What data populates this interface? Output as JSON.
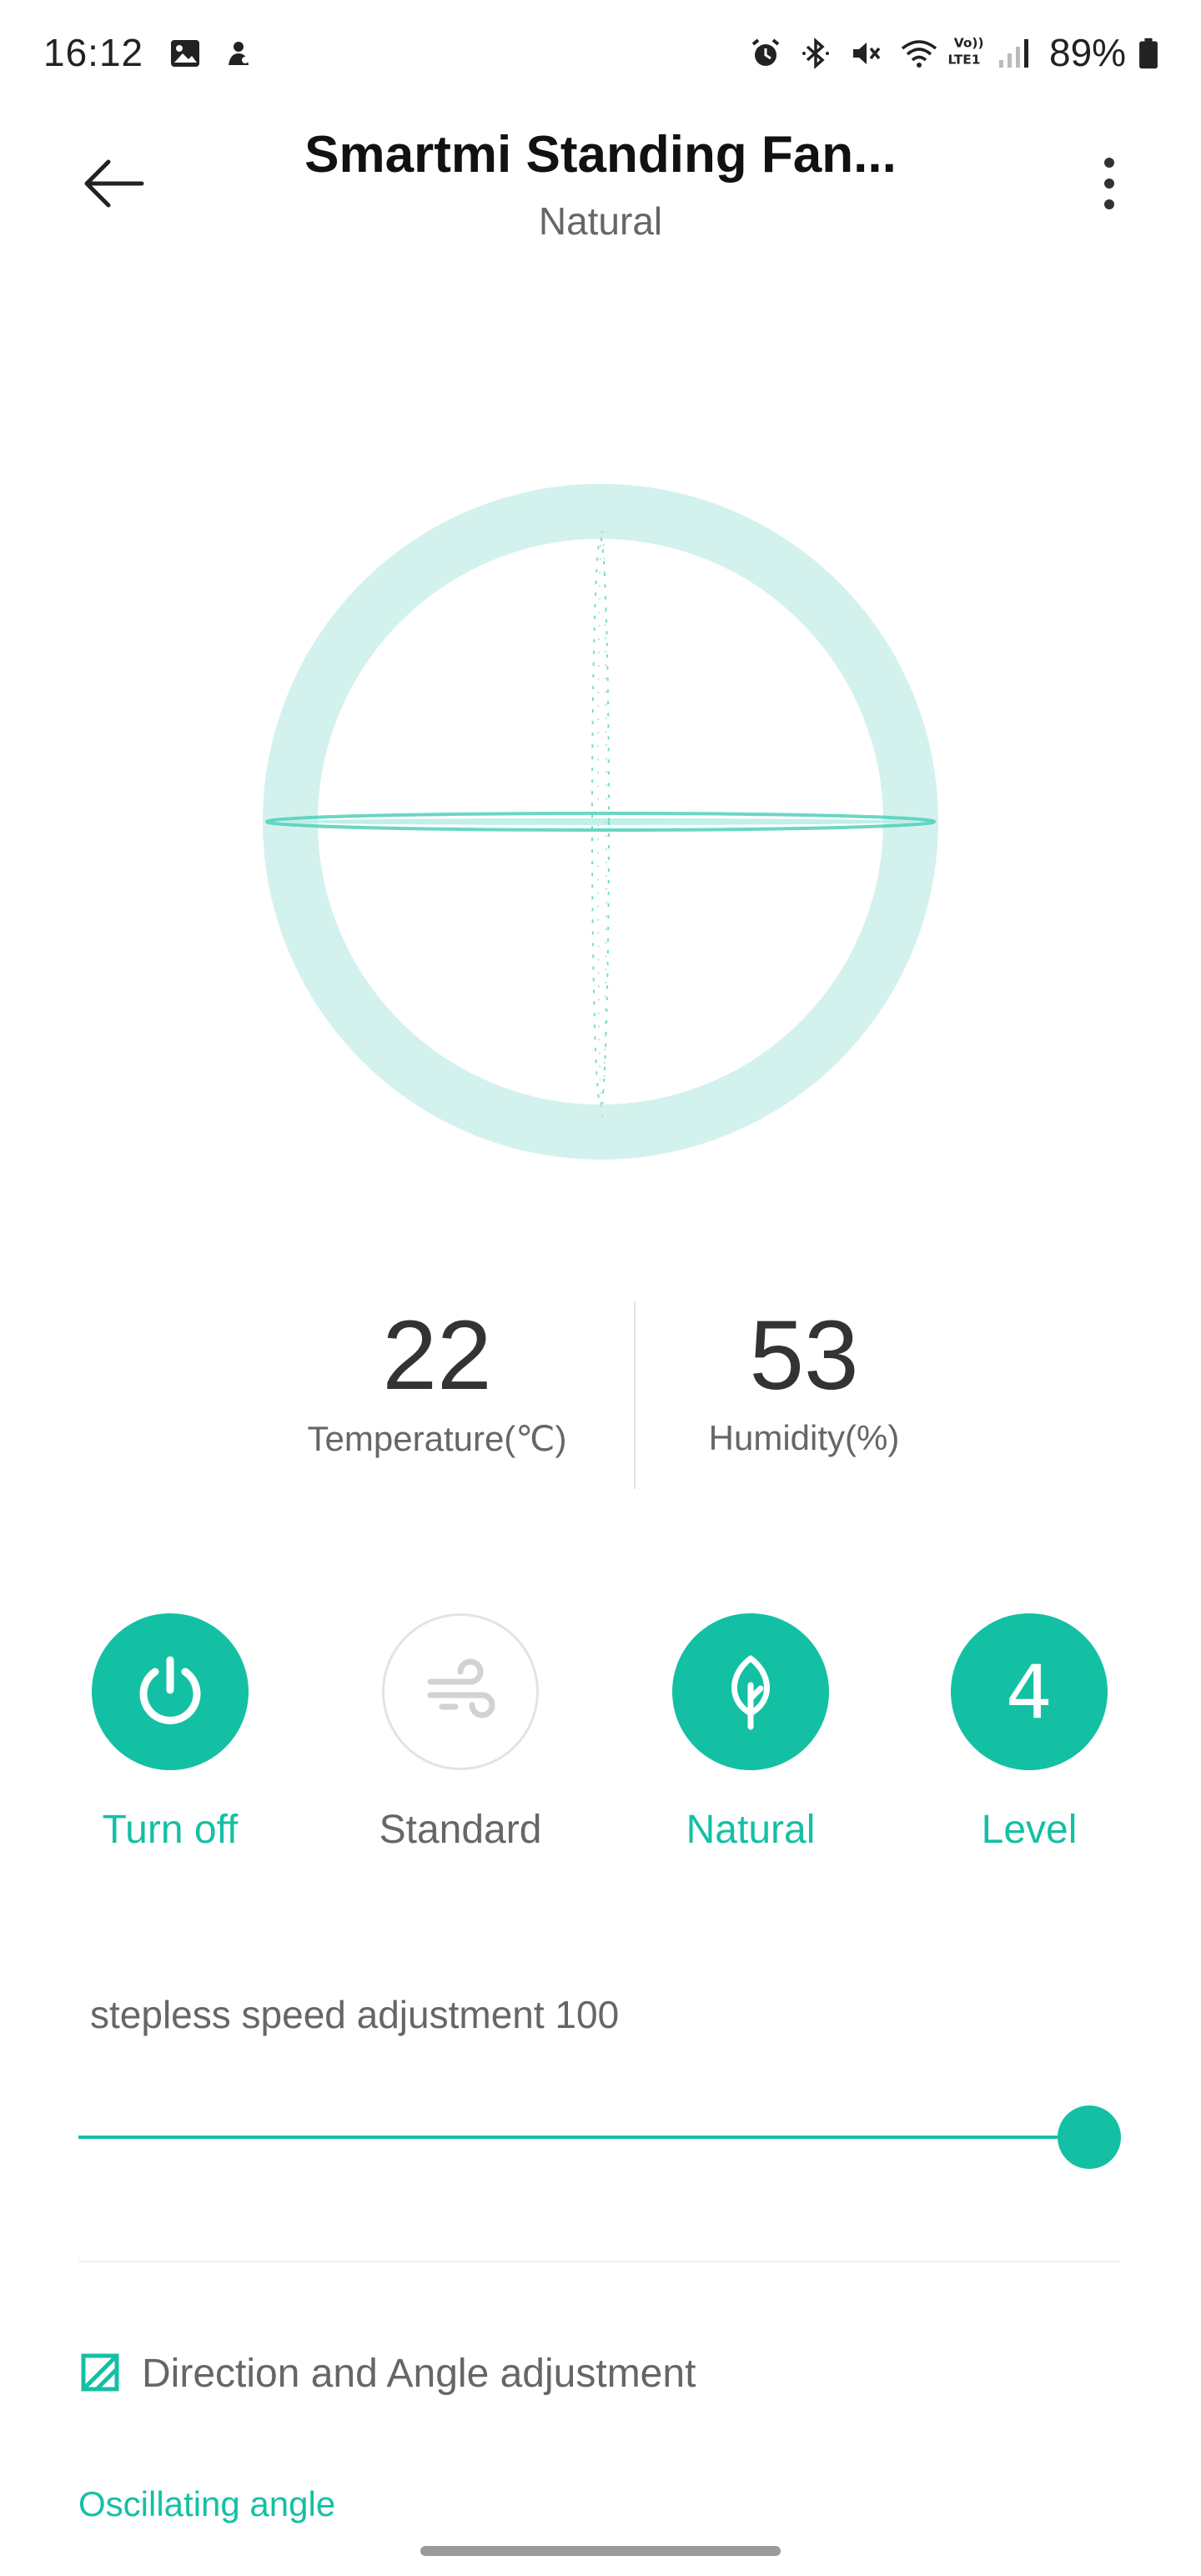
{
  "status_bar": {
    "time": "16:12",
    "battery_percent": "89%",
    "battery_level": 0.89,
    "icons": [
      "gallery-icon",
      "notification-icon",
      "alarm-icon",
      "bluetooth-icon",
      "mute-icon",
      "wifi-icon",
      "volte-icon",
      "signal-icon",
      "battery-icon"
    ],
    "volte_label": "Vo)) LTE1"
  },
  "header": {
    "title": "Smartmi Standing Fan...",
    "subtitle": "Natural"
  },
  "sensors": {
    "temperature": {
      "value": "22",
      "label": "Temperature(℃)"
    },
    "humidity": {
      "value": "53",
      "label": "Humidity(%)"
    }
  },
  "modes": [
    {
      "label": "Turn off",
      "icon": "power-icon",
      "active": true
    },
    {
      "label": "Standard",
      "icon": "wind-icon",
      "active": false
    },
    {
      "label": "Natural",
      "icon": "leaf-icon",
      "active": true
    },
    {
      "label": "Level",
      "value": "4",
      "active": true
    }
  ],
  "speed": {
    "label": "stepless speed adjustment 100",
    "value": 100,
    "max": 100
  },
  "direction": {
    "label": "Direction and Angle adjustment",
    "icon": "adjust-icon"
  },
  "oscillating": {
    "label": "Oscillating angle"
  },
  "colors": {
    "accent": "#14c0a4",
    "ring": "#d4f2ed",
    "text_secondary": "#666666"
  }
}
